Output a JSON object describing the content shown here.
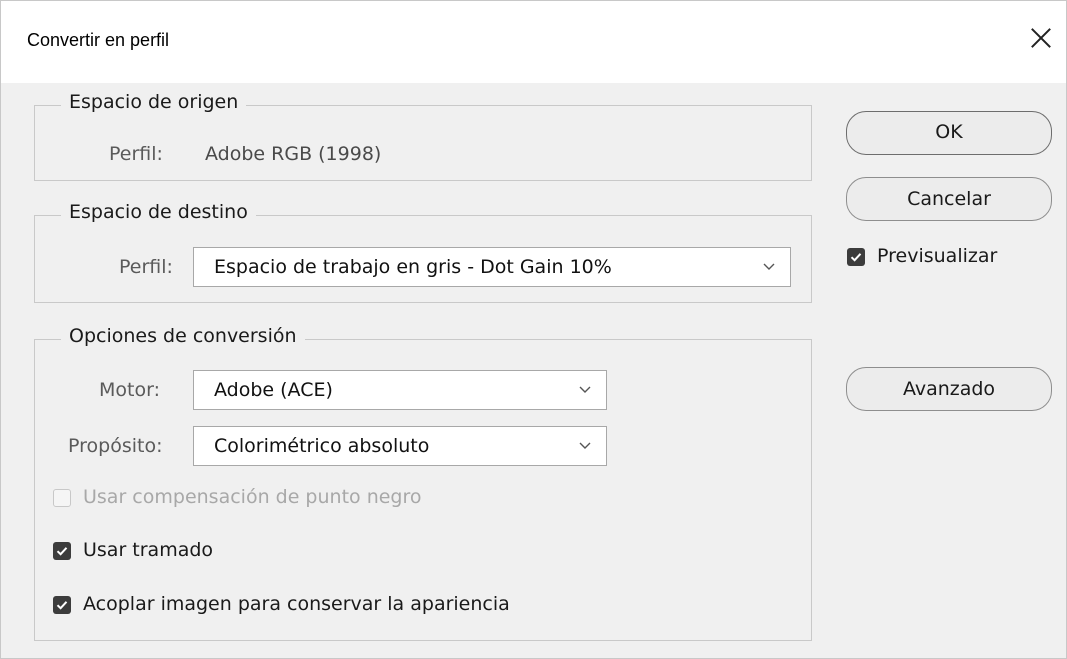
{
  "dialog": {
    "title": "Convertir en perfil"
  },
  "source_space": {
    "legend": "Espacio de origen",
    "profile_label": "Perfil:",
    "profile_value": "Adobe RGB (1998)"
  },
  "dest_space": {
    "legend": "Espacio de destino",
    "profile_label": "Perfil:",
    "profile_selected": "Espacio de trabajo en gris - Dot Gain 10%"
  },
  "conversion": {
    "legend": "Opciones de conversión",
    "engine_label": "Motor:",
    "engine_selected": "Adobe (ACE)",
    "intent_label": "Propósito:",
    "intent_selected": "Colorimétrico absoluto",
    "black_point_label": "Usar compensación de punto negro",
    "black_point_checked": false,
    "black_point_enabled": false,
    "dither_label": "Usar tramado",
    "dither_checked": true,
    "flatten_label": "Acoplar imagen para conservar la apariencia",
    "flatten_checked": true
  },
  "buttons": {
    "ok": "OK",
    "cancel": "Cancelar",
    "advanced": "Avanzado"
  },
  "preview": {
    "label": "Previsualizar",
    "checked": true
  },
  "colors": {
    "dialog_bg": "#f0f0f0",
    "checkbox_on": "#3c3c3c",
    "disabled_text": "#a8a8a8"
  },
  "icons": {
    "close": "close-icon",
    "dropdown": "chevron-down-icon",
    "check": "checkmark-icon"
  }
}
